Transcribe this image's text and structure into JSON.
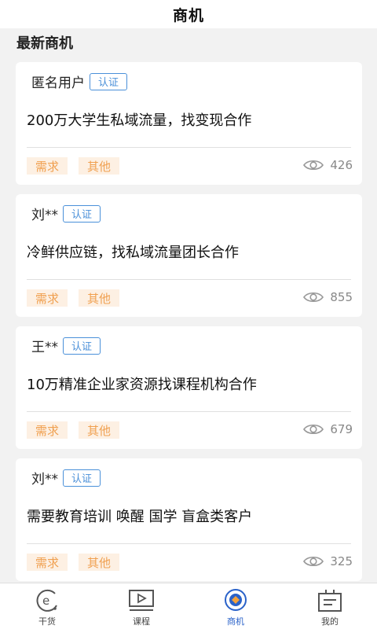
{
  "header": {
    "title": "商机"
  },
  "section": {
    "title": "最新商机"
  },
  "cards": [
    {
      "user": "匿名用户",
      "badge": "认证",
      "title": "200万大学生私域流量，找变现合作",
      "tags": [
        "需求",
        "其他"
      ],
      "views": "426"
    },
    {
      "user": "刘**",
      "badge": "认证",
      "title": "冷鲜供应链，找私域流量团长合作",
      "tags": [
        "需求",
        "其他"
      ],
      "views": "855"
    },
    {
      "user": "王**",
      "badge": "认证",
      "title": "10万精准企业家资源找课程机构合作",
      "tags": [
        "需求",
        "其他"
      ],
      "views": "679"
    },
    {
      "user": "刘**",
      "badge": "认证",
      "title": "需要教育培训 唤醒 国学 盲盒类客户",
      "tags": [
        "需求",
        "其他"
      ],
      "views": "325"
    }
  ],
  "tabs": [
    {
      "label": "干货",
      "icon": "e-circle-icon"
    },
    {
      "label": "课程",
      "icon": "video-player-icon"
    },
    {
      "label": "商机",
      "icon": "target-circle-icon",
      "active": true
    },
    {
      "label": "我的",
      "icon": "profile-box-icon"
    }
  ],
  "colors": {
    "badge": "#4a90d9",
    "tag_text": "#f0a050",
    "tag_bg": "#fdf0e3",
    "active_tab": "#2a62c9"
  }
}
